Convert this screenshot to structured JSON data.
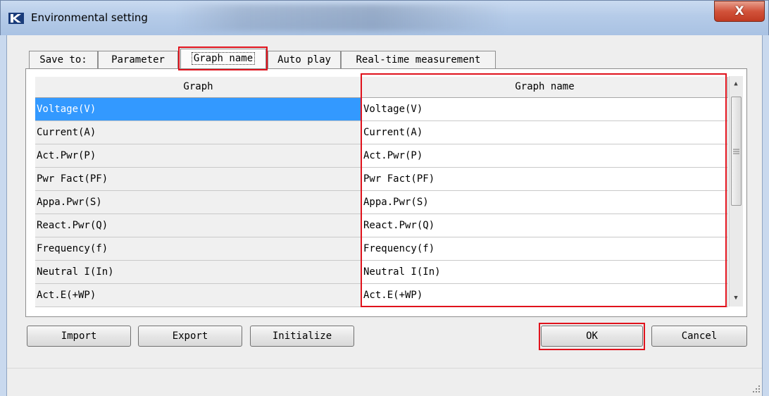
{
  "window": {
    "title": "Environmental setting",
    "close_label": "X"
  },
  "tabs": [
    {
      "label": "Save to:"
    },
    {
      "label": "Parameter"
    },
    {
      "label": "Graph name",
      "active": true
    },
    {
      "label": "Auto play"
    },
    {
      "label": "Real-time measurement"
    }
  ],
  "grid": {
    "columns": [
      "Graph",
      "Graph name"
    ],
    "rows": [
      {
        "graph": "Voltage(V)",
        "graph_name": "Voltage(V)",
        "selected": true
      },
      {
        "graph": "Current(A)",
        "graph_name": "Current(A)"
      },
      {
        "graph": "Act.Pwr(P)",
        "graph_name": "Act.Pwr(P)"
      },
      {
        "graph": "Pwr Fact(PF)",
        "graph_name": "Pwr Fact(PF)"
      },
      {
        "graph": "Appa.Pwr(S)",
        "graph_name": "Appa.Pwr(S)"
      },
      {
        "graph": "React.Pwr(Q)",
        "graph_name": "React.Pwr(Q)"
      },
      {
        "graph": "Frequency(f)",
        "graph_name": "Frequency(f)"
      },
      {
        "graph": "Neutral I(In)",
        "graph_name": "Neutral I(In)"
      },
      {
        "graph": "Act.E(+WP)",
        "graph_name": "Act.E(+WP)"
      }
    ]
  },
  "buttons": {
    "import": "Import",
    "export": "Export",
    "initialize": "Initialize",
    "ok": "OK",
    "cancel": "Cancel"
  },
  "colors": {
    "highlight_box": "#e0121c",
    "selection": "#3399ff"
  },
  "icons": {
    "app": "k-logo-icon",
    "scroll_up": "chevron-up-icon",
    "scroll_down": "chevron-down-icon",
    "resize": "resize-grip-icon"
  }
}
